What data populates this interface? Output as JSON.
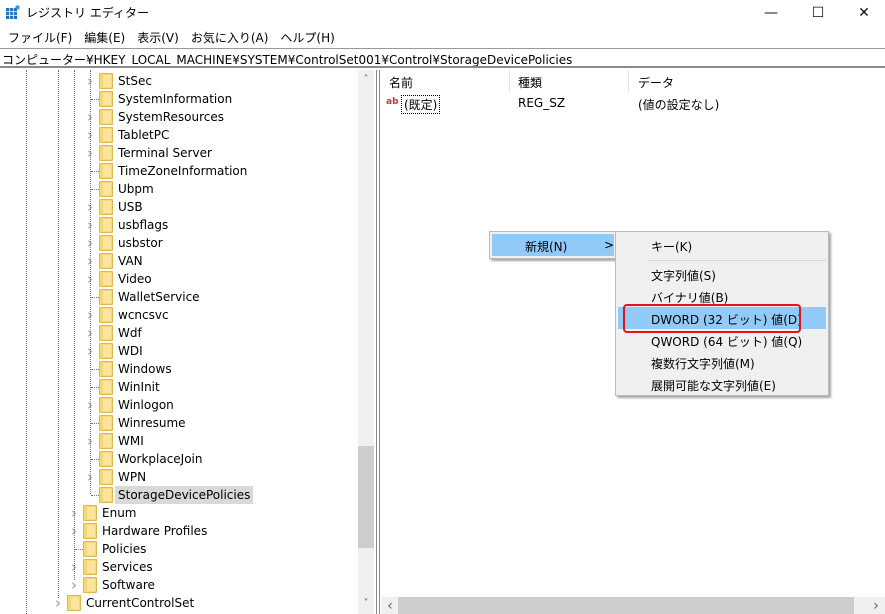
{
  "window": {
    "title": "レジストリ エディター",
    "controls": {
      "minimize": "—",
      "maximize": "☐",
      "close": "✕"
    }
  },
  "menubar": [
    "ファイル(F)",
    "編集(E)",
    "表示(V)",
    "お気に入り(A)",
    "ヘルプ(H)"
  ],
  "address": "コンピューター¥HKEY_LOCAL_MACHINE¥SYSTEM¥ControlSet001¥Control¥StorageDevicePolicies",
  "tree": {
    "level3": [
      {
        "label": "StSec",
        "expandable": true
      },
      {
        "label": "SystemInformation",
        "expandable": false
      },
      {
        "label": "SystemResources",
        "expandable": true
      },
      {
        "label": "TabletPC",
        "expandable": true
      },
      {
        "label": "Terminal Server",
        "expandable": true
      },
      {
        "label": "TimeZoneInformation",
        "expandable": false
      },
      {
        "label": "Ubpm",
        "expandable": false
      },
      {
        "label": "USB",
        "expandable": true
      },
      {
        "label": "usbflags",
        "expandable": true
      },
      {
        "label": "usbstor",
        "expandable": true
      },
      {
        "label": "VAN",
        "expandable": true
      },
      {
        "label": "Video",
        "expandable": true
      },
      {
        "label": "WalletService",
        "expandable": false
      },
      {
        "label": "wcncsvc",
        "expandable": true
      },
      {
        "label": "Wdf",
        "expandable": true
      },
      {
        "label": "WDI",
        "expandable": true
      },
      {
        "label": "Windows",
        "expandable": false
      },
      {
        "label": "WinInit",
        "expandable": false
      },
      {
        "label": "Winlogon",
        "expandable": true
      },
      {
        "label": "Winresume",
        "expandable": false
      },
      {
        "label": "WMI",
        "expandable": true
      },
      {
        "label": "WorkplaceJoin",
        "expandable": false
      },
      {
        "label": "WPN",
        "expandable": true
      },
      {
        "label": "StorageDevicePolicies",
        "expandable": false,
        "selected": true
      }
    ],
    "level2": [
      {
        "label": "Enum",
        "expandable": true
      },
      {
        "label": "Hardware Profiles",
        "expandable": true
      },
      {
        "label": "Policies",
        "expandable": false
      },
      {
        "label": "Services",
        "expandable": true
      },
      {
        "label": "Software",
        "expandable": true
      }
    ],
    "level1": [
      {
        "label": "CurrentControlSet",
        "expandable": true
      }
    ]
  },
  "list": {
    "columns": [
      "名前",
      "種類",
      "データ"
    ],
    "rows": [
      {
        "icon": "ab",
        "name": "(既定)",
        "type": "REG_SZ",
        "data": "(値の設定なし)"
      }
    ]
  },
  "context_menu": {
    "new_label": "新規(N)",
    "submenu_arrow": ">",
    "submenu": [
      {
        "label": "キー(K)"
      },
      {
        "label": "文字列値(S)"
      },
      {
        "label": "バイナリ値(B)"
      },
      {
        "label": "DWORD (32 ビット) 値(D)",
        "highlighted": true
      },
      {
        "label": "QWORD (64 ビット) 値(Q)"
      },
      {
        "label": "複数行文字列値(M)"
      },
      {
        "label": "展開可能な文字列値(E)"
      }
    ]
  },
  "colors": {
    "menu_highlight": "#91c9f7",
    "annotation_box": "#e3121c",
    "folder": "#f8d775",
    "selected_bg": "#d9d9d9"
  }
}
